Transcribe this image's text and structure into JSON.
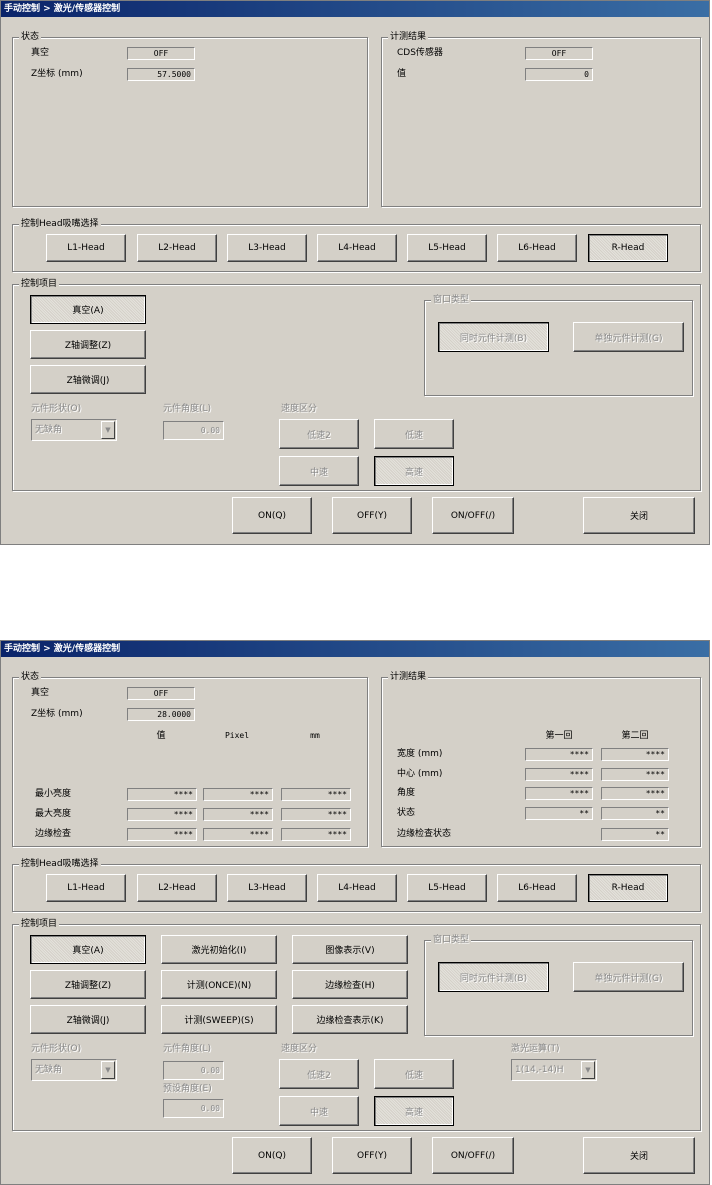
{
  "window1": {
    "title": "手动控制 > 激光/传感器控制",
    "status_group": {
      "label": "状态",
      "vacuum_label": "真空",
      "vacuum_value": "OFF",
      "z_label": "Z坐标 (mm)",
      "z_value": "57.5000"
    },
    "measure_group": {
      "label": "计测结果",
      "cds_label": "CDS传感器",
      "cds_value": "OFF",
      "value_label": "值",
      "value_value": "0"
    },
    "head_group": {
      "label": "控制Head吸嘴选择",
      "heads": [
        "L1-Head",
        "L2-Head",
        "L3-Head",
        "L4-Head",
        "L5-Head",
        "L6-Head",
        "R-Head"
      ]
    },
    "control_group": {
      "label": "控制项目",
      "vacuum_btn": "真空(A)",
      "z_adjust_btn": "Z轴调整(Z)",
      "z_fine_btn": "Z轴微调(J)",
      "shape_label": "元件形状(O)",
      "shape_value": "无缺角",
      "angle_label": "元件角度(L)",
      "angle_value": "0.00",
      "speed_label": "速度区分",
      "speed_btns": [
        "低速2",
        "低速",
        "中速",
        "高速"
      ],
      "window_type_label": "窗口类型",
      "same_time_btn": "同时元件计测(B)",
      "single_btn": "单独元件计测(G)"
    },
    "bottom": {
      "on": "ON(Q)",
      "off": "OFF(Y)",
      "onoff": "ON/OFF(/)",
      "close": "关闭"
    }
  },
  "window2": {
    "title": "手动控制 > 激光/传感器控制",
    "status_group": {
      "label": "状态",
      "vacuum_label": "真空",
      "vacuum_value": "OFF",
      "z_label": "Z坐标 (mm)",
      "z_value": "28.0000",
      "col_value": "值",
      "col_pixel": "Pixel",
      "col_mm": "mm",
      "rows": [
        {
          "label": "最小亮度",
          "v1": "****",
          "v2": "****",
          "v3": "****"
        },
        {
          "label": "最大亮度",
          "v1": "****",
          "v2": "****",
          "v3": "****"
        },
        {
          "label": "边缘检查",
          "v1": "****",
          "v2": "****",
          "v3": "****"
        }
      ]
    },
    "measure_group": {
      "label": "计测结果",
      "col_first": "第一回",
      "col_second": "第二回",
      "rows": [
        {
          "label": "宽度 (mm)",
          "v1": "****",
          "v2": "****"
        },
        {
          "label": "中心 (mm)",
          "v1": "****",
          "v2": "****"
        },
        {
          "label": "角度",
          "v1": "****",
          "v2": "****"
        },
        {
          "label": "状态",
          "v1": "**",
          "v2": "**"
        }
      ],
      "edge_label": "边缘检查状态",
      "edge_value": "**"
    },
    "head_group": {
      "label": "控制Head吸嘴选择",
      "heads": [
        "L1-Head",
        "L2-Head",
        "L3-Head",
        "L4-Head",
        "L5-Head",
        "L6-Head",
        "R-Head"
      ]
    },
    "control_group": {
      "label": "控制项目",
      "vacuum_btn": "真空(A)",
      "z_adjust_btn": "Z轴调整(Z)",
      "z_fine_btn": "Z轴微调(J)",
      "laser_init_btn": "激光初始化(I)",
      "measure_once_btn": "计测(ONCE)(N)",
      "measure_sweep_btn": "计测(SWEEP)(S)",
      "image_btn": "图像表示(V)",
      "edge_check_btn": "边缘检查(H)",
      "edge_show_btn": "边缘检查表示(K)",
      "shape_label": "元件形状(O)",
      "shape_value": "无缺角",
      "angle_label": "元件角度(L)",
      "angle_value": "0.00",
      "preset_label": "预设角度(E)",
      "preset_value": "0.00",
      "speed_label": "速度区分",
      "speed_btns": [
        "低速2",
        "低速",
        "中速",
        "高速"
      ],
      "window_type_label": "窗口类型",
      "same_time_btn": "同时元件计测(B)",
      "single_btn": "单独元件计测(G)",
      "laser_calc_label": "激光运算(T)",
      "laser_calc_value": "1(14,-14)H"
    },
    "bottom": {
      "on": "ON(Q)",
      "off": "OFF(Y)",
      "onoff": "ON/OFF(/)",
      "close": "关闭"
    }
  }
}
